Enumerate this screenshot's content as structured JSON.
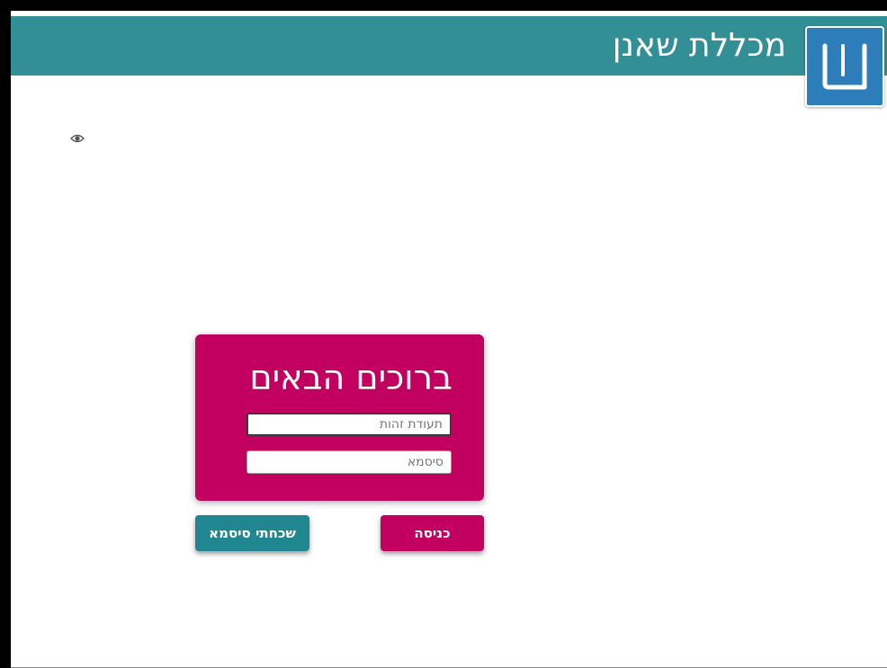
{
  "header": {
    "title": "מכללת שאנן",
    "logo_icon": "shin-letter-logo-icon",
    "background_color": "#338f96"
  },
  "login": {
    "title": "ברוכים הבאים",
    "id_placeholder": "תעודת זהות",
    "password_placeholder": "סיסמא",
    "show_password_icon": "eye-icon",
    "card_color": "#c2005f"
  },
  "buttons": {
    "login_label": "כניסה",
    "forgot_label": "שכחתי סיסמא",
    "forgot_color": "#20868f"
  }
}
